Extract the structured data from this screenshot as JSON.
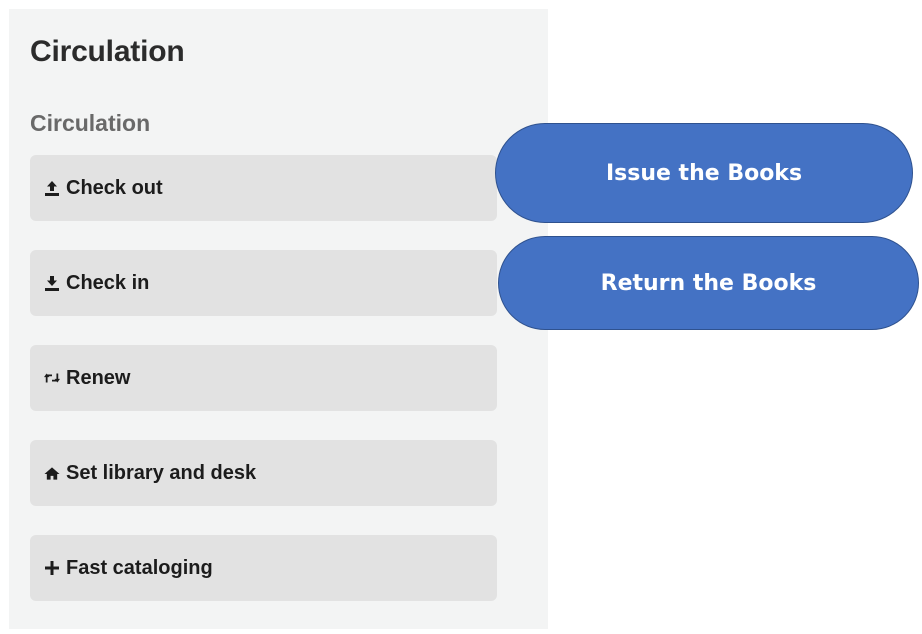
{
  "panel": {
    "title": "Circulation",
    "section_title": "Circulation",
    "items": [
      {
        "label": "Check out",
        "icon": "upload-tray-icon"
      },
      {
        "label": "Check in",
        "icon": "download-tray-icon"
      },
      {
        "label": "Renew",
        "icon": "retweet-icon"
      },
      {
        "label": "Set library and desk",
        "icon": "home-icon"
      },
      {
        "label": "Fast cataloging",
        "icon": "plus-icon"
      }
    ]
  },
  "callouts": {
    "issue": "Issue the Books",
    "return": "Return the Books"
  },
  "colors": {
    "panel_bg": "#f3f4f4",
    "button_bg": "#e2e2e2",
    "callout_fill": "#4472c4",
    "callout_border": "#2f528f"
  }
}
